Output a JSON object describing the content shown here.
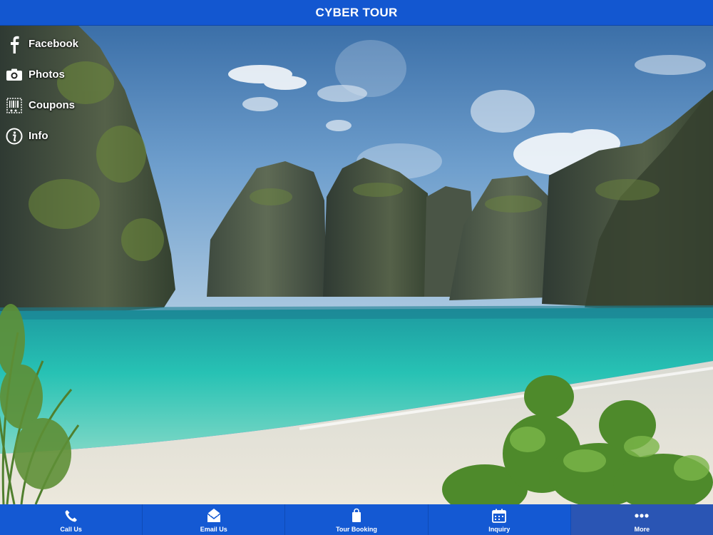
{
  "header": {
    "title": "CYBER TOUR"
  },
  "side_menu": [
    {
      "label": "Facebook",
      "icon": "facebook-icon"
    },
    {
      "label": "Photos",
      "icon": "camera-icon"
    },
    {
      "label": "Coupons",
      "icon": "barcode-scissors-icon"
    },
    {
      "label": "Info",
      "icon": "info-icon"
    }
  ],
  "tabs": [
    {
      "label": "Call Us",
      "icon": "phone-icon"
    },
    {
      "label": "Email Us",
      "icon": "envelope-icon"
    },
    {
      "label": "Tour Booking",
      "icon": "shopping-bag-icon"
    },
    {
      "label": "Inquiry",
      "icon": "calendar-icon"
    },
    {
      "label": "More",
      "icon": "more-dots-icon",
      "active": true
    }
  ],
  "colors": {
    "brand": "#1357d0",
    "active_tab": "#2a55b4",
    "text": "#ffffff"
  }
}
